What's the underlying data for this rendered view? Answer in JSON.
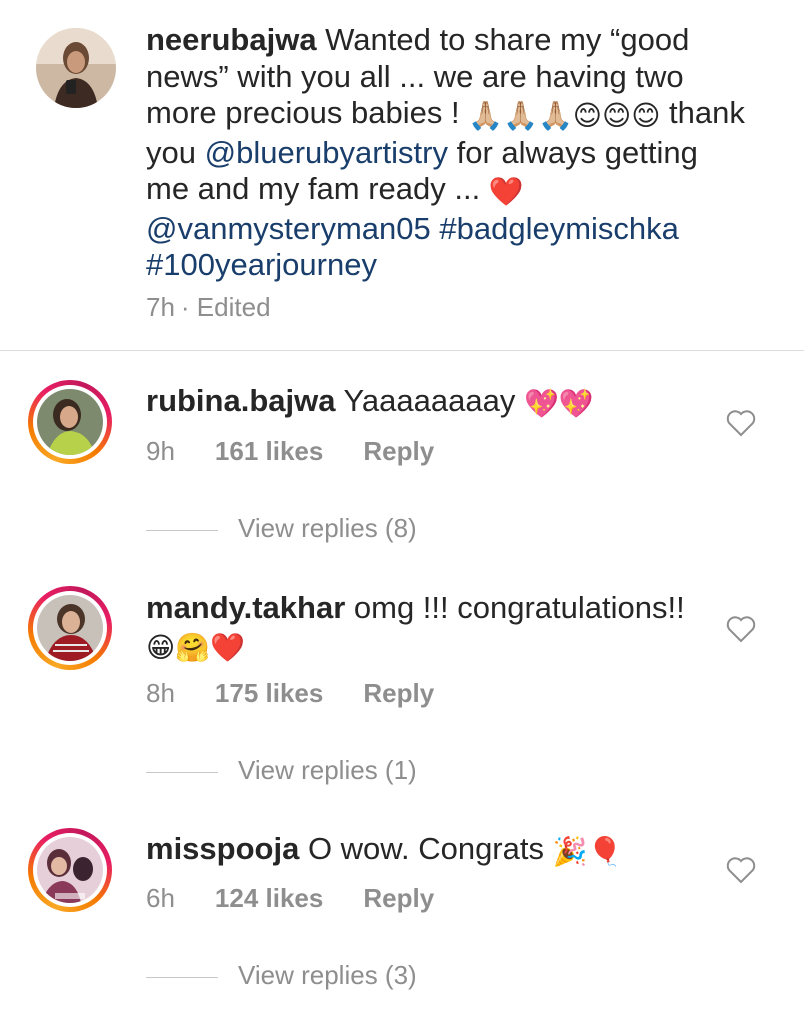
{
  "caption": {
    "username": "neerubajwa",
    "text_1": " Wanted to share my “good news” with you all ... we are having two more precious babies ! ",
    "emojis_1": "🙏🏼🙏🏼🙏🏼😊😊😊",
    "text_2": " thank you ",
    "mention_1": "@bluerubyartistry",
    "text_3": " for always getting me and my fam ready ... ",
    "emoji_heart": "❤️",
    "mention_2": "@vanmysteryman05",
    "hashtag_1": "#badgleymischka",
    "hashtag_2": "#100yearjourney",
    "time": "7h",
    "edited": "· Edited"
  },
  "comments": [
    {
      "username": "rubina.bajwa",
      "text": " Yaaaaaaaay ",
      "emojis": "💖💖",
      "time": "9h",
      "likes": "161 likes",
      "reply": "Reply",
      "view_replies": "View replies (8)"
    },
    {
      "username": "mandy.takhar",
      "text": " omg !!! congratulations!! ",
      "emojis": "😁🤗❤️",
      "time": "8h",
      "likes": "175 likes",
      "reply": "Reply",
      "view_replies": "View replies (1)"
    },
    {
      "username": "misspooja",
      "text": " O wow. Congrats ",
      "emojis": "🎉🎈",
      "time": "6h",
      "likes": "124 likes",
      "reply": "Reply",
      "view_replies": "View replies (3)"
    }
  ]
}
